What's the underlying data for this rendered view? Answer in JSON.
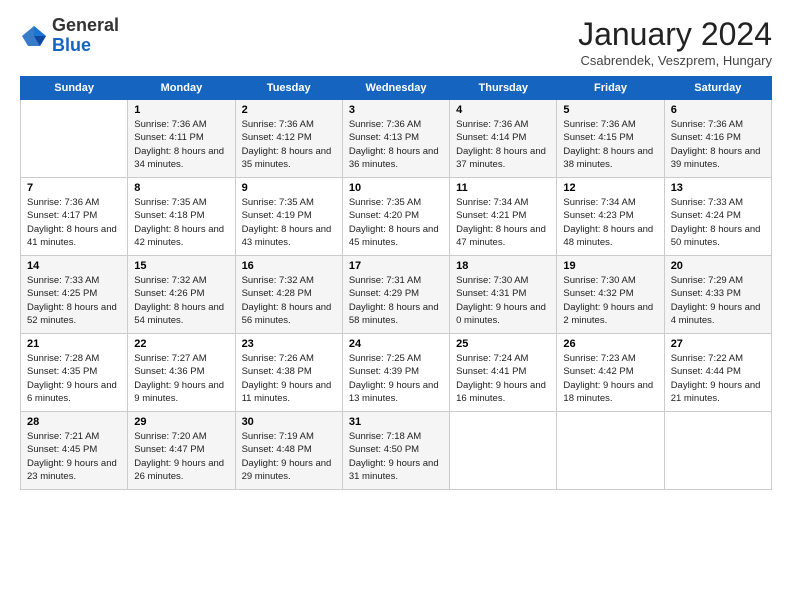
{
  "logo": {
    "general": "General",
    "blue": "Blue"
  },
  "header": {
    "month": "January 2024",
    "location": "Csabrendek, Veszprem, Hungary"
  },
  "days_of_week": [
    "Sunday",
    "Monday",
    "Tuesday",
    "Wednesday",
    "Thursday",
    "Friday",
    "Saturday"
  ],
  "weeks": [
    [
      {
        "num": "",
        "sunrise": "",
        "sunset": "",
        "daylight": ""
      },
      {
        "num": "1",
        "sunrise": "Sunrise: 7:36 AM",
        "sunset": "Sunset: 4:11 PM",
        "daylight": "Daylight: 8 hours and 34 minutes."
      },
      {
        "num": "2",
        "sunrise": "Sunrise: 7:36 AM",
        "sunset": "Sunset: 4:12 PM",
        "daylight": "Daylight: 8 hours and 35 minutes."
      },
      {
        "num": "3",
        "sunrise": "Sunrise: 7:36 AM",
        "sunset": "Sunset: 4:13 PM",
        "daylight": "Daylight: 8 hours and 36 minutes."
      },
      {
        "num": "4",
        "sunrise": "Sunrise: 7:36 AM",
        "sunset": "Sunset: 4:14 PM",
        "daylight": "Daylight: 8 hours and 37 minutes."
      },
      {
        "num": "5",
        "sunrise": "Sunrise: 7:36 AM",
        "sunset": "Sunset: 4:15 PM",
        "daylight": "Daylight: 8 hours and 38 minutes."
      },
      {
        "num": "6",
        "sunrise": "Sunrise: 7:36 AM",
        "sunset": "Sunset: 4:16 PM",
        "daylight": "Daylight: 8 hours and 39 minutes."
      }
    ],
    [
      {
        "num": "7",
        "sunrise": "Sunrise: 7:36 AM",
        "sunset": "Sunset: 4:17 PM",
        "daylight": "Daylight: 8 hours and 41 minutes."
      },
      {
        "num": "8",
        "sunrise": "Sunrise: 7:35 AM",
        "sunset": "Sunset: 4:18 PM",
        "daylight": "Daylight: 8 hours and 42 minutes."
      },
      {
        "num": "9",
        "sunrise": "Sunrise: 7:35 AM",
        "sunset": "Sunset: 4:19 PM",
        "daylight": "Daylight: 8 hours and 43 minutes."
      },
      {
        "num": "10",
        "sunrise": "Sunrise: 7:35 AM",
        "sunset": "Sunset: 4:20 PM",
        "daylight": "Daylight: 8 hours and 45 minutes."
      },
      {
        "num": "11",
        "sunrise": "Sunrise: 7:34 AM",
        "sunset": "Sunset: 4:21 PM",
        "daylight": "Daylight: 8 hours and 47 minutes."
      },
      {
        "num": "12",
        "sunrise": "Sunrise: 7:34 AM",
        "sunset": "Sunset: 4:23 PM",
        "daylight": "Daylight: 8 hours and 48 minutes."
      },
      {
        "num": "13",
        "sunrise": "Sunrise: 7:33 AM",
        "sunset": "Sunset: 4:24 PM",
        "daylight": "Daylight: 8 hours and 50 minutes."
      }
    ],
    [
      {
        "num": "14",
        "sunrise": "Sunrise: 7:33 AM",
        "sunset": "Sunset: 4:25 PM",
        "daylight": "Daylight: 8 hours and 52 minutes."
      },
      {
        "num": "15",
        "sunrise": "Sunrise: 7:32 AM",
        "sunset": "Sunset: 4:26 PM",
        "daylight": "Daylight: 8 hours and 54 minutes."
      },
      {
        "num": "16",
        "sunrise": "Sunrise: 7:32 AM",
        "sunset": "Sunset: 4:28 PM",
        "daylight": "Daylight: 8 hours and 56 minutes."
      },
      {
        "num": "17",
        "sunrise": "Sunrise: 7:31 AM",
        "sunset": "Sunset: 4:29 PM",
        "daylight": "Daylight: 8 hours and 58 minutes."
      },
      {
        "num": "18",
        "sunrise": "Sunrise: 7:30 AM",
        "sunset": "Sunset: 4:31 PM",
        "daylight": "Daylight: 9 hours and 0 minutes."
      },
      {
        "num": "19",
        "sunrise": "Sunrise: 7:30 AM",
        "sunset": "Sunset: 4:32 PM",
        "daylight": "Daylight: 9 hours and 2 minutes."
      },
      {
        "num": "20",
        "sunrise": "Sunrise: 7:29 AM",
        "sunset": "Sunset: 4:33 PM",
        "daylight": "Daylight: 9 hours and 4 minutes."
      }
    ],
    [
      {
        "num": "21",
        "sunrise": "Sunrise: 7:28 AM",
        "sunset": "Sunset: 4:35 PM",
        "daylight": "Daylight: 9 hours and 6 minutes."
      },
      {
        "num": "22",
        "sunrise": "Sunrise: 7:27 AM",
        "sunset": "Sunset: 4:36 PM",
        "daylight": "Daylight: 9 hours and 9 minutes."
      },
      {
        "num": "23",
        "sunrise": "Sunrise: 7:26 AM",
        "sunset": "Sunset: 4:38 PM",
        "daylight": "Daylight: 9 hours and 11 minutes."
      },
      {
        "num": "24",
        "sunrise": "Sunrise: 7:25 AM",
        "sunset": "Sunset: 4:39 PM",
        "daylight": "Daylight: 9 hours and 13 minutes."
      },
      {
        "num": "25",
        "sunrise": "Sunrise: 7:24 AM",
        "sunset": "Sunset: 4:41 PM",
        "daylight": "Daylight: 9 hours and 16 minutes."
      },
      {
        "num": "26",
        "sunrise": "Sunrise: 7:23 AM",
        "sunset": "Sunset: 4:42 PM",
        "daylight": "Daylight: 9 hours and 18 minutes."
      },
      {
        "num": "27",
        "sunrise": "Sunrise: 7:22 AM",
        "sunset": "Sunset: 4:44 PM",
        "daylight": "Daylight: 9 hours and 21 minutes."
      }
    ],
    [
      {
        "num": "28",
        "sunrise": "Sunrise: 7:21 AM",
        "sunset": "Sunset: 4:45 PM",
        "daylight": "Daylight: 9 hours and 23 minutes."
      },
      {
        "num": "29",
        "sunrise": "Sunrise: 7:20 AM",
        "sunset": "Sunset: 4:47 PM",
        "daylight": "Daylight: 9 hours and 26 minutes."
      },
      {
        "num": "30",
        "sunrise": "Sunrise: 7:19 AM",
        "sunset": "Sunset: 4:48 PM",
        "daylight": "Daylight: 9 hours and 29 minutes."
      },
      {
        "num": "31",
        "sunrise": "Sunrise: 7:18 AM",
        "sunset": "Sunset: 4:50 PM",
        "daylight": "Daylight: 9 hours and 31 minutes."
      },
      {
        "num": "",
        "sunrise": "",
        "sunset": "",
        "daylight": ""
      },
      {
        "num": "",
        "sunrise": "",
        "sunset": "",
        "daylight": ""
      },
      {
        "num": "",
        "sunrise": "",
        "sunset": "",
        "daylight": ""
      }
    ]
  ]
}
